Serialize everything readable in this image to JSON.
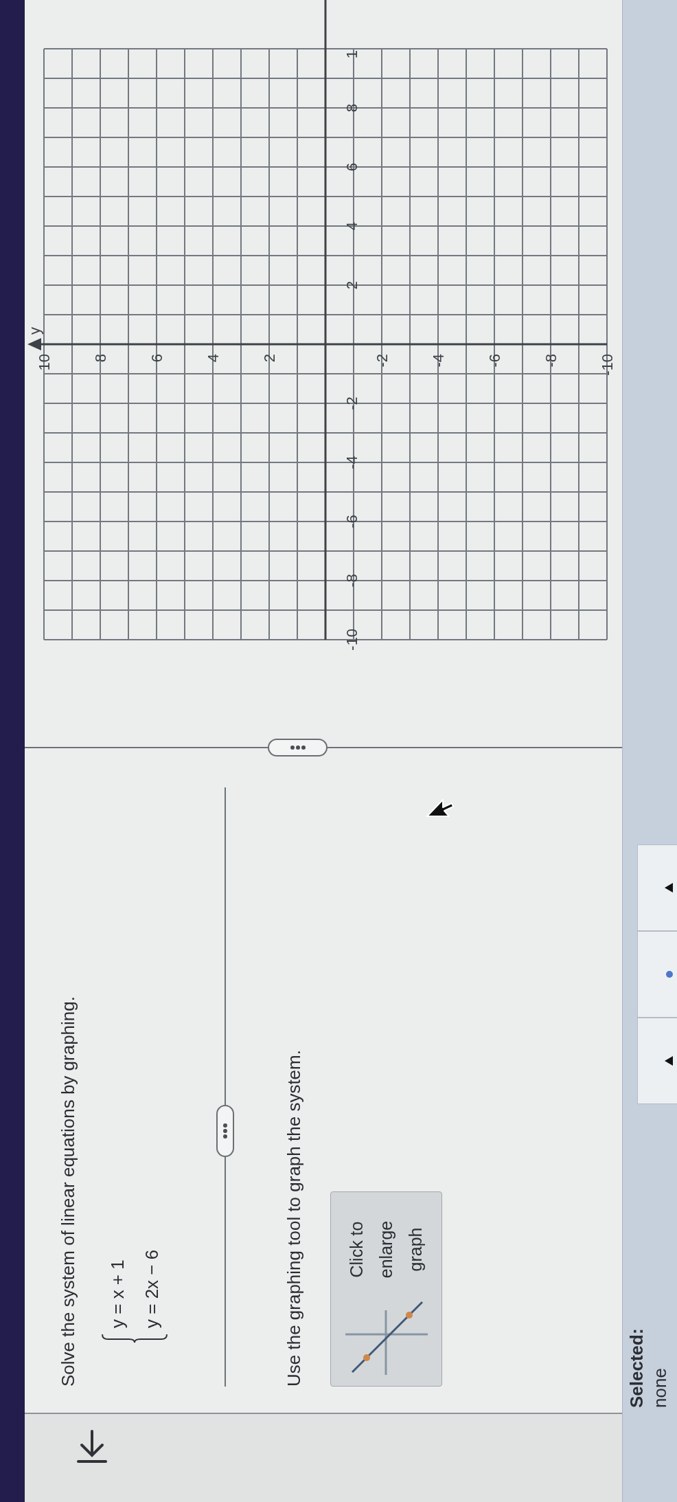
{
  "question": {
    "prompt": "Solve the system of linear equations by graphing.",
    "system": [
      "y = x + 1",
      "y = 2x − 6"
    ]
  },
  "instruction": "Use the graphing tool to graph the system.",
  "enlarge_button": {
    "label": "Click to enlarge graph"
  },
  "graph": {
    "axis_label": "y",
    "x_tick_labels": [
      "-10",
      "-8",
      "-6",
      "-4",
      "-2",
      "2",
      "4",
      "6",
      "8",
      "1"
    ],
    "y_tick_labels": [
      "-10",
      "-8",
      "-6",
      "-4",
      "-2",
      "2",
      "4",
      "6",
      "8",
      "10"
    ]
  },
  "footer": {
    "selected_label": "Selected:",
    "selected_value": "none",
    "tools": [
      {
        "kind": "triangle"
      },
      {
        "kind": "dot"
      },
      {
        "kind": "triangle"
      }
    ]
  }
}
